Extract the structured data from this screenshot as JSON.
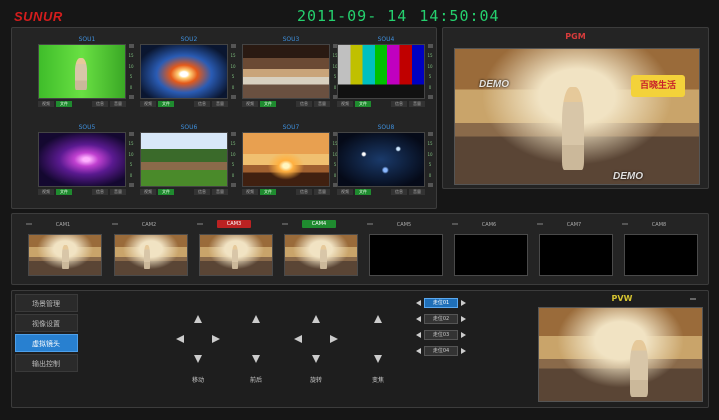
{
  "brand": "SUNUR",
  "datetime": {
    "date": "2011-09- 14",
    "time": "14:50:04"
  },
  "sources": [
    {
      "title": "SOU1",
      "b1": "视频",
      "b2": "文件",
      "b3": "信息",
      "b4": "音量"
    },
    {
      "title": "SOU2",
      "b1": "视频",
      "b2": "文件",
      "b3": "信息",
      "b4": "音量"
    },
    {
      "title": "SOU3",
      "b1": "视频",
      "b2": "文件",
      "b3": "信息",
      "b4": "音量"
    },
    {
      "title": "SOU4",
      "b1": "视频",
      "b2": "文件",
      "b3": "信息",
      "b4": "音量"
    },
    {
      "title": "SOU5",
      "b1": "视频",
      "b2": "文件",
      "b3": "信息",
      "b4": "音量"
    },
    {
      "title": "SOU6",
      "b1": "视频",
      "b2": "文件",
      "b3": "信息",
      "b4": "音量"
    },
    {
      "title": "SOU7",
      "b1": "视频",
      "b2": "文件",
      "b3": "信息",
      "b4": "音量"
    },
    {
      "title": "SOU8",
      "b1": "视频",
      "b2": "文件",
      "b3": "信息",
      "b4": "音量"
    }
  ],
  "side_ticks": [
    "15",
    "10",
    "5",
    "0"
  ],
  "pgm": {
    "title": "PGM",
    "overlay": "DEMO",
    "overlay2": "DEMO",
    "logo": "百晓生活"
  },
  "cams": [
    "CAM1",
    "CAM2",
    "CAM3",
    "CAM4",
    "CAM5",
    "CAM6",
    "CAM7",
    "CAM8"
  ],
  "menu": [
    "场景管理",
    "视像设置",
    "虚拟镜头",
    "输出控制"
  ],
  "ptz": [
    "移动",
    "前后",
    "旋转",
    "变焦"
  ],
  "positions": [
    "走位01",
    "走位02",
    "走位03",
    "走位04"
  ],
  "pvw": {
    "title": "PVW"
  },
  "colors": {
    "pgm": "#d63b3b",
    "pvw": "#d6c431",
    "active": "#2880d0",
    "on": "#1f8b2f",
    "clock": "#25d06e"
  }
}
